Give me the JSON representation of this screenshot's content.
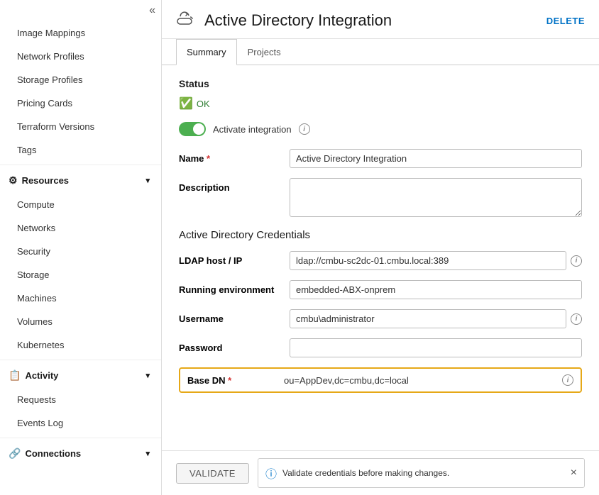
{
  "sidebar": {
    "collapse_icon": "«",
    "items": [
      {
        "id": "image-mappings",
        "label": "Image Mappings",
        "indent": true
      },
      {
        "id": "network-profiles",
        "label": "Network Profiles",
        "indent": true
      },
      {
        "id": "storage-profiles",
        "label": "Storage Profiles",
        "indent": true
      },
      {
        "id": "pricing-cards",
        "label": "Pricing Cards",
        "indent": true
      },
      {
        "id": "terraform-versions",
        "label": "Terraform Versions",
        "indent": true
      },
      {
        "id": "tags",
        "label": "Tags",
        "indent": true
      }
    ],
    "resources_label": "Resources",
    "resources_children": [
      {
        "id": "compute",
        "label": "Compute"
      },
      {
        "id": "networks",
        "label": "Networks"
      },
      {
        "id": "security",
        "label": "Security"
      },
      {
        "id": "storage",
        "label": "Storage"
      },
      {
        "id": "machines",
        "label": "Machines"
      },
      {
        "id": "volumes",
        "label": "Volumes"
      },
      {
        "id": "kubernetes",
        "label": "Kubernetes"
      }
    ],
    "activity_label": "Activity",
    "activity_children": [
      {
        "id": "requests",
        "label": "Requests"
      },
      {
        "id": "events-log",
        "label": "Events Log"
      }
    ],
    "connections_label": "Connections"
  },
  "header": {
    "icon": "🔄",
    "title": "Active Directory Integration",
    "delete_label": "DELETE"
  },
  "tabs": [
    {
      "id": "summary",
      "label": "Summary",
      "active": true
    },
    {
      "id": "projects",
      "label": "Projects",
      "active": false
    }
  ],
  "status": {
    "label": "Status",
    "value": "OK"
  },
  "toggle": {
    "label": "Activate integration",
    "enabled": true
  },
  "form": {
    "name_label": "Name",
    "name_value": "Active Directory Integration",
    "name_placeholder": "",
    "description_label": "Description",
    "description_value": "",
    "description_placeholder": ""
  },
  "credentials": {
    "section_title": "Active Directory Credentials",
    "ldap_label": "LDAP host / IP",
    "ldap_value": "ldap://cmbu-sc2dc-01.cmbu.local:389",
    "running_env_label": "Running environment",
    "running_env_value": "embedded-ABX-onprem",
    "username_label": "Username",
    "username_value": "cmbu\\administrator",
    "password_label": "Password",
    "password_value": "",
    "basedn_label": "Base DN",
    "basedn_value": "ou=AppDev,dc=cmbu,dc=local"
  },
  "footer": {
    "validate_label": "VALIDATE",
    "tooltip_text": "Validate credentials before making changes.",
    "close_icon": "×"
  }
}
